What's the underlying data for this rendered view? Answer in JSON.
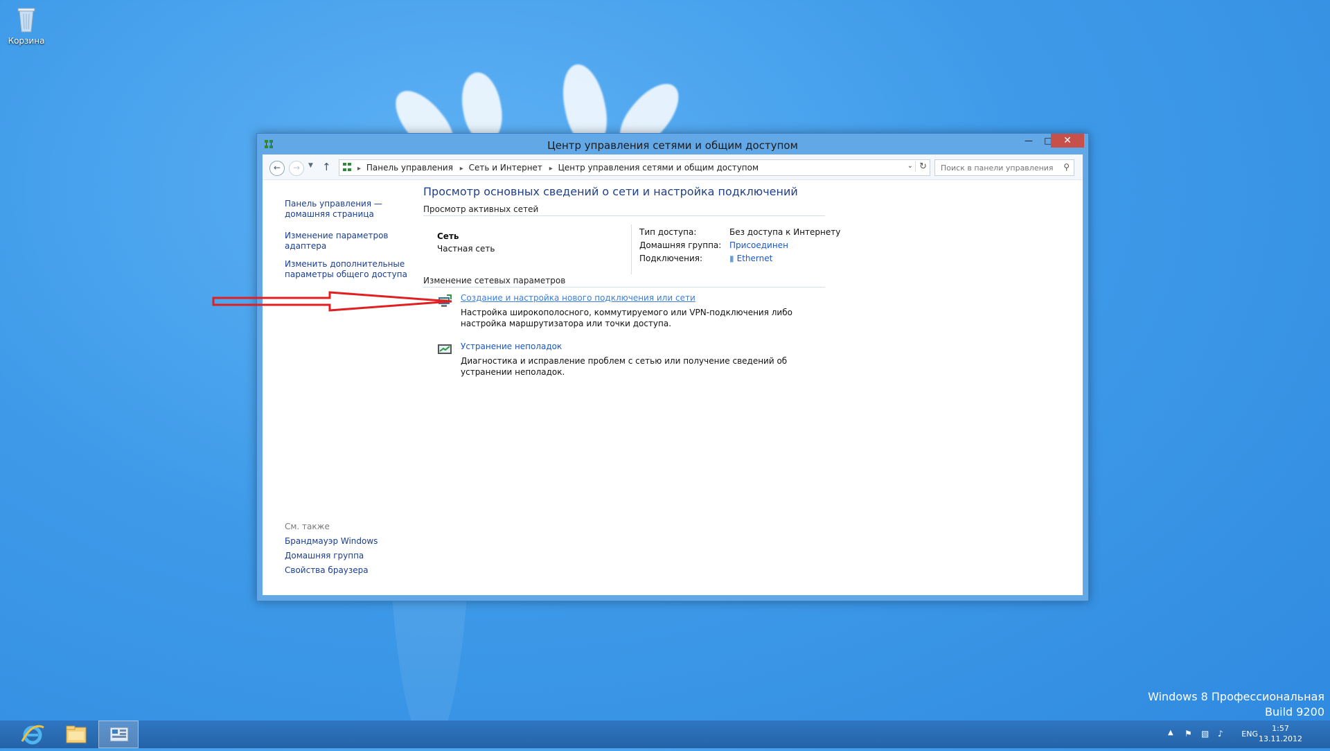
{
  "desktop": {
    "recycle_bin_label": "Корзина",
    "watermark_line1": "Windows 8 Профессиональная",
    "watermark_line2": "Build 9200"
  },
  "window": {
    "title": "Центр управления сетями и общим доступом",
    "close_glyph": "✕",
    "minimize_glyph": "—",
    "maximize_glyph": "□"
  },
  "navbar": {
    "breadcrumbs": [
      "Панель управления",
      "Сеть и Интернет",
      "Центр управления сетями и общим доступом"
    ],
    "search_placeholder": "Поиск в панели управления"
  },
  "sidebar": {
    "links": [
      "Панель управления — домашняя страница",
      "Изменение параметров адаптера",
      "Изменить дополнительные параметры общего доступа"
    ],
    "see_also_title": "См. также",
    "see_also_links": [
      "Брандмауэр Windows",
      "Домашняя группа",
      "Свойства браузера"
    ]
  },
  "main": {
    "title": "Просмотр основных сведений о сети и настройка подключений",
    "active_networks_heading": "Просмотр активных сетей",
    "network": {
      "name": "Сеть",
      "type": "Частная сеть",
      "props": [
        {
          "label": "Тип доступа:",
          "value": "Без доступа к Интернету"
        },
        {
          "label": "Домашняя группа:",
          "value": "Присоединен"
        },
        {
          "label": "Подключения:",
          "value": "Ethernet"
        }
      ]
    },
    "change_settings_heading": "Изменение сетевых параметров",
    "tasks": [
      {
        "link": "Создание и настройка нового подключения или сети",
        "desc": "Настройка широкополосного, коммутируемого или VPN-подключения либо настройка маршрутизатора или точки доступа."
      },
      {
        "link": "Устранение неполадок",
        "desc": "Диагностика и исправление проблем с сетью или получение сведений об устранении неполадок."
      }
    ]
  },
  "taskbar": {
    "language": "ENG",
    "time": "1:57",
    "date": "13.11.2012"
  },
  "colors": {
    "link": "#1a58c7",
    "close_button": "#c7504a",
    "annotation_arrow": "#e02020"
  }
}
